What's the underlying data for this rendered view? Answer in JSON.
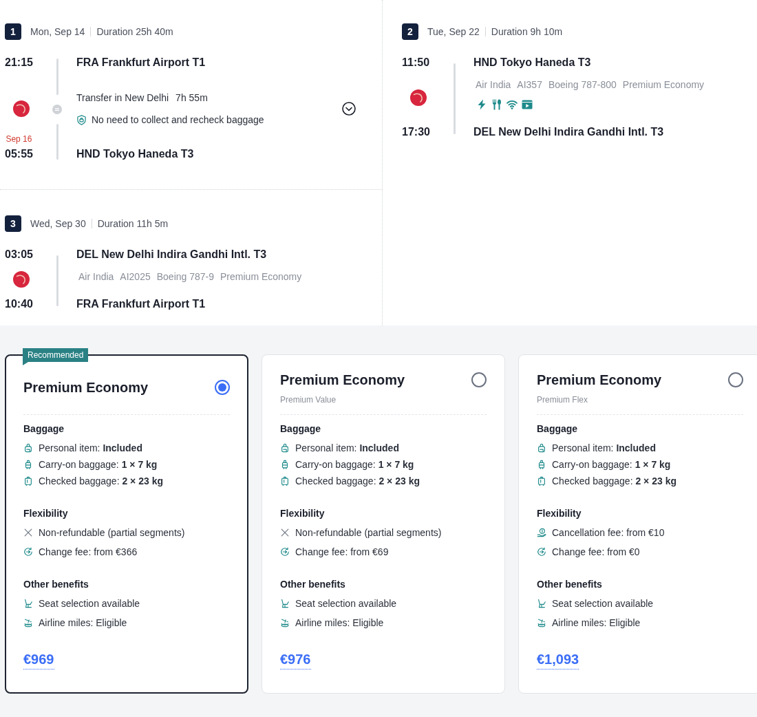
{
  "segments": [
    {
      "number": "1",
      "date": "Mon, Sep 14",
      "duration": "Duration 25h 40m",
      "departure": {
        "time": "21:15",
        "airport": "FRA Frankfurt Airport T1"
      },
      "transfer": {
        "label": "Transfer in New Delhi",
        "duration": "7h 55m",
        "note": "No need to collect and recheck baggage",
        "expanded": false
      },
      "arrival": {
        "date_note": "Sep 16",
        "time": "05:55",
        "airport": "HND Tokyo Haneda T3"
      }
    },
    {
      "number": "2",
      "date": "Tue, Sep 22",
      "duration": "Duration 9h 10m",
      "departure": {
        "time": "11:50",
        "airport": "HND Tokyo Haneda T3"
      },
      "flight": {
        "airline": "Air India",
        "flight_number": "AI357",
        "aircraft": "Boeing 787-800",
        "cabin": "Premium Economy"
      },
      "amenities": [
        {
          "kind": "power"
        },
        {
          "kind": "meal"
        },
        {
          "kind": "wifi"
        },
        {
          "kind": "entertainment"
        }
      ],
      "arrival": {
        "time": "17:30",
        "airport": "DEL New Delhi Indira Gandhi Intl. T3"
      }
    },
    {
      "number": "3",
      "date": "Wed, Sep 30",
      "duration": "Duration 11h 5m",
      "departure": {
        "time": "03:05",
        "airport": "DEL New Delhi Indira Gandhi Intl. T3"
      },
      "flight": {
        "airline": "Air India",
        "flight_number": "AI2025",
        "aircraft": "Boeing 787-9",
        "cabin": "Premium Economy"
      },
      "arrival": {
        "time": "10:40",
        "airport": "FRA Frankfurt Airport T1"
      }
    }
  ],
  "fares": [
    {
      "badge": "Recommended",
      "title": "Premium Economy",
      "selected": true,
      "sections": [
        {
          "heading": "Baggage",
          "items": [
            {
              "kind": "personal_item",
              "text": "Personal item: **Included**"
            },
            {
              "kind": "carry_on",
              "text": "Carry-on baggage: **1 × 7 kg**"
            },
            {
              "kind": "checked_bag",
              "text": "Checked baggage: **2 × 23 kg**"
            }
          ]
        },
        {
          "heading": "Flexibility",
          "items": [
            {
              "kind": "no_refund",
              "text": "Non-refundable (partial segments)"
            },
            {
              "kind": "change_fee",
              "text": "Change fee: from €366"
            }
          ]
        },
        {
          "heading": "Other benefits",
          "items": [
            {
              "kind": "seat",
              "text": "Seat selection available"
            },
            {
              "kind": "miles",
              "text": "Airline miles: Eligible"
            }
          ]
        }
      ],
      "price": "€969"
    },
    {
      "title": "Premium Economy",
      "subtitle": "Premium Value",
      "selected": false,
      "sections": [
        {
          "heading": "Baggage",
          "items": [
            {
              "kind": "personal_item",
              "text": "Personal item: **Included**"
            },
            {
              "kind": "carry_on",
              "text": "Carry-on baggage: **1 × 7 kg**"
            },
            {
              "kind": "checked_bag",
              "text": "Checked baggage: **2 × 23 kg**"
            }
          ]
        },
        {
          "heading": "Flexibility",
          "items": [
            {
              "kind": "no_refund",
              "text": "Non-refundable (partial segments)"
            },
            {
              "kind": "change_fee",
              "text": "Change fee: from €69"
            }
          ]
        },
        {
          "heading": "Other benefits",
          "items": [
            {
              "kind": "seat",
              "text": "Seat selection available"
            },
            {
              "kind": "miles",
              "text": "Airline miles: Eligible"
            }
          ]
        }
      ],
      "price": "€976"
    },
    {
      "title": "Premium Economy",
      "subtitle": "Premium Flex",
      "selected": false,
      "sections": [
        {
          "heading": "Baggage",
          "items": [
            {
              "kind": "personal_item",
              "text": "Personal item: **Included**"
            },
            {
              "kind": "carry_on",
              "text": "Carry-on baggage: **1 × 7 kg**"
            },
            {
              "kind": "checked_bag",
              "text": "Checked baggage: **2 × 23 kg**"
            }
          ]
        },
        {
          "heading": "Flexibility",
          "items": [
            {
              "kind": "cancellation_fee",
              "text": "Cancellation fee: from €10"
            },
            {
              "kind": "change_fee",
              "text": "Change fee: from €0"
            }
          ]
        },
        {
          "heading": "Other benefits",
          "items": [
            {
              "kind": "seat",
              "text": "Seat selection available"
            },
            {
              "kind": "miles",
              "text": "Airline miles: Eligible"
            }
          ]
        }
      ],
      "price": "€1,093"
    }
  ]
}
